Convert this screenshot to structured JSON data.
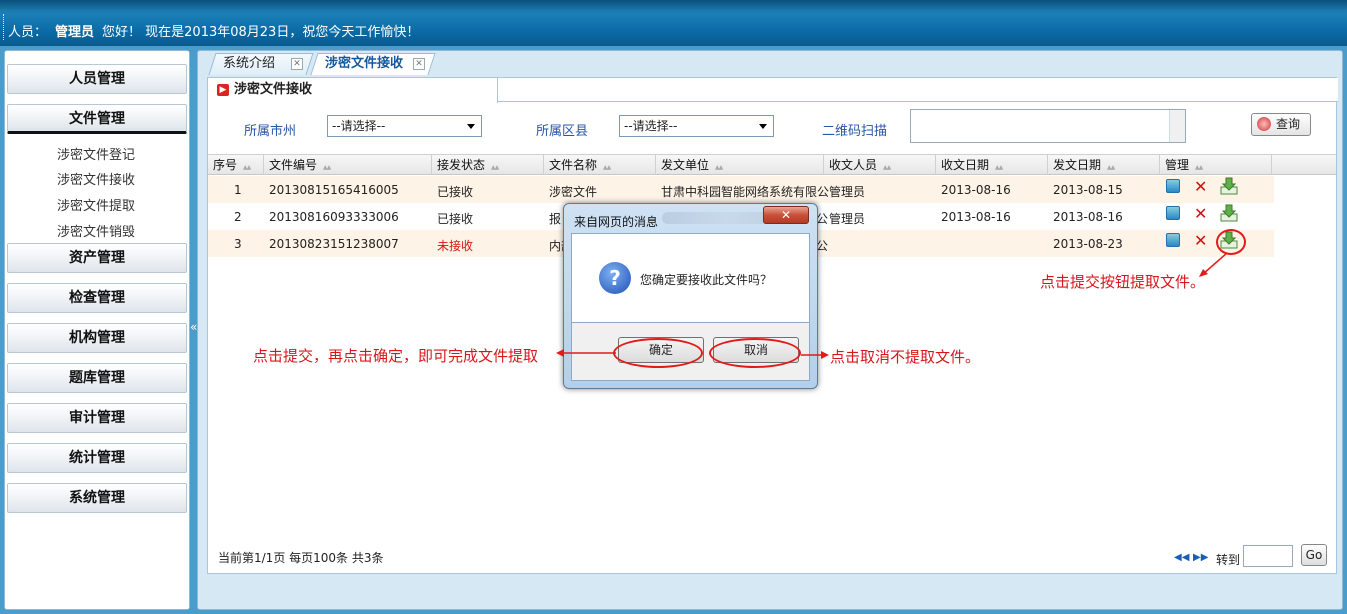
{
  "header": {
    "user_prefix": "人员：",
    "user_name": "管理员",
    "greeting": "您好！ 现在是2013年08月23日，祝您今天工作愉快！"
  },
  "sidebar": {
    "menus": [
      {
        "label": "人员管理"
      },
      {
        "label": "文件管理",
        "active": true
      },
      {
        "label": "资产管理"
      },
      {
        "label": "检查管理"
      },
      {
        "label": "机构管理"
      },
      {
        "label": "题库管理"
      },
      {
        "label": "审计管理"
      },
      {
        "label": "统计管理"
      },
      {
        "label": "系统管理"
      }
    ],
    "sub_items": [
      "涉密文件登记",
      "涉密文件接收",
      "涉密文件提取",
      "涉密文件销毁"
    ],
    "collapse_glyph": "«"
  },
  "tabs": [
    {
      "label": "系统介绍",
      "close": "✕"
    },
    {
      "label": "涉密文件接收",
      "close": "✕",
      "active": true
    }
  ],
  "panel": {
    "title": "涉密文件接收",
    "filters": {
      "city_label": "所属市州",
      "city_value": "--请选择--",
      "district_label": "所属区县",
      "district_value": "--请选择--",
      "qr_label": "二维码扫描",
      "query_button": "查询"
    }
  },
  "grid": {
    "columns": [
      "序号",
      "文件编号",
      "接发状态",
      "文件名称",
      "发文单位",
      "收文人员",
      "收文日期",
      "发文日期",
      "管理"
    ],
    "rows": [
      {
        "no": "1",
        "code": "20130815165416005",
        "status": "已接收",
        "name": "涉密文件",
        "unit": "甘肃中科园智能网络系统有限公",
        "receiver": "管理员",
        "recv_date": "2013-08-16",
        "send_date": "2013-08-15"
      },
      {
        "no": "2",
        "code": "20130816093333006",
        "status": "已接收",
        "name": "报",
        "unit": "公",
        "receiver": "管理员",
        "recv_date": "2013-08-16",
        "send_date": "2013-08-16"
      },
      {
        "no": "3",
        "code": "20130823151238007",
        "status": "未接收",
        "name": "内部",
        "unit": "公",
        "receiver": "",
        "recv_date": "",
        "send_date": "2013-08-23"
      }
    ]
  },
  "pager": {
    "info": "当前第1/1页  每页100条  共3条",
    "first": "◀◀",
    "last": "▶▶",
    "goto_label": "转到",
    "go_button": "Go"
  },
  "dialog": {
    "title": "来自网页的消息",
    "close": "✕",
    "question_glyph": "?",
    "message": "您确定要接收此文件吗？",
    "ok": "确定",
    "cancel": "取消"
  },
  "annotations": {
    "download_hint": "点击提交按钮提取文件。",
    "ok_hint": "点击提交，再点击确定，即可完成文件提取",
    "cancel_hint": "点击取消不提取文件。"
  },
  "colors": {
    "annotation": "#d8161a",
    "status_unreceived": "#d11111",
    "header_bg": "#1c80b8"
  }
}
